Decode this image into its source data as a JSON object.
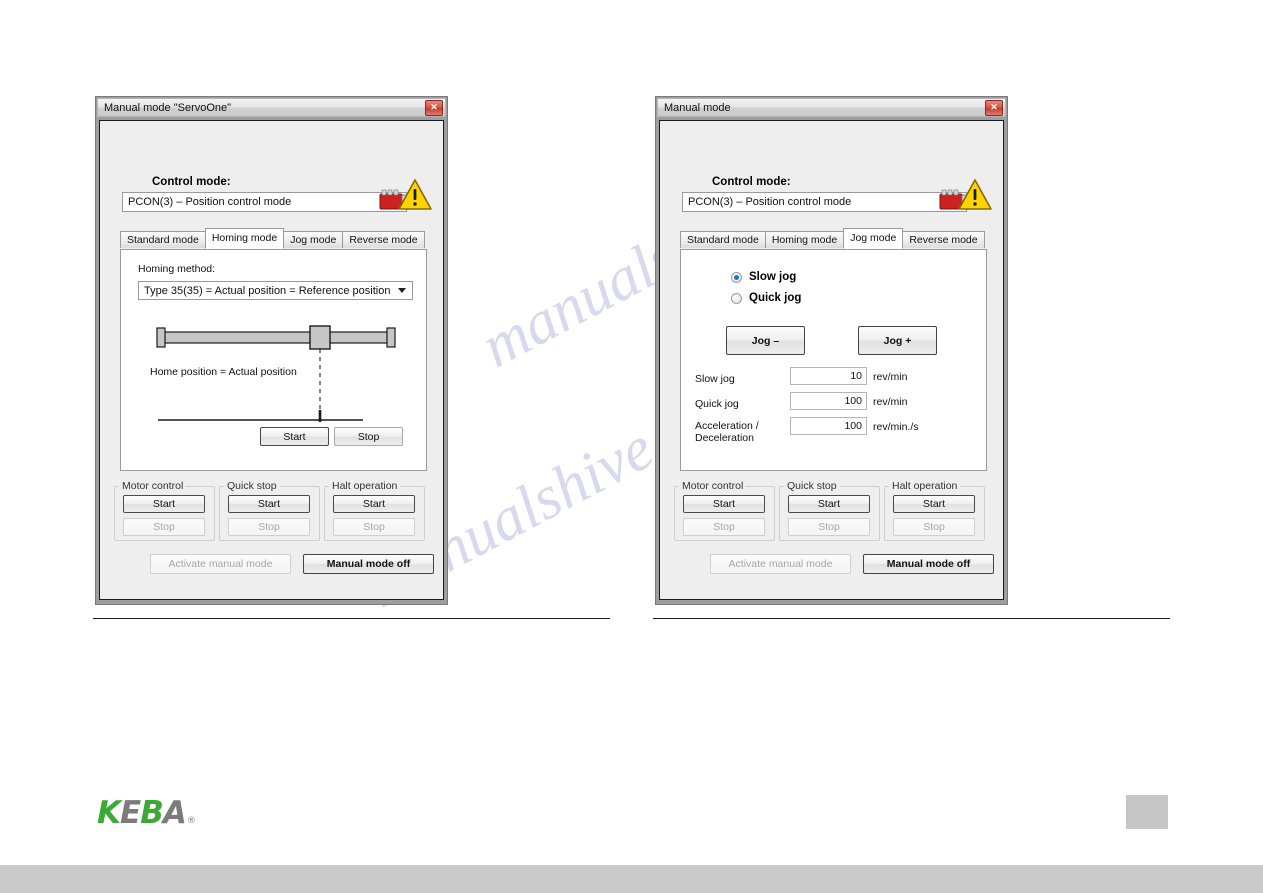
{
  "page": {
    "watermark_line1": "manualshive.com",
    "watermark_line2": "manualshive.com"
  },
  "brand": {
    "name_parts": [
      "K",
      "E",
      "B",
      "A"
    ],
    "trademark": "®",
    "green": "#3aa935",
    "gray": "#7b7b7b"
  },
  "common": {
    "control_mode_label": "Control mode:",
    "control_mode_value": "PCON(3) – Position control mode",
    "tabs": [
      {
        "label": "Standard mode"
      },
      {
        "label": "Homing mode"
      },
      {
        "label": "Jog mode"
      },
      {
        "label": "Reverse mode"
      }
    ],
    "groups": [
      {
        "title": "Motor control",
        "start": "Start",
        "stop": "Stop"
      },
      {
        "title": "Quick stop",
        "start": "Start",
        "stop": "Stop"
      },
      {
        "title": "Halt operation",
        "start": "Start",
        "stop": "Stop"
      }
    ],
    "activate_manual_mode": "Activate manual mode",
    "manual_mode_off": "Manual mode off",
    "close_glyph": "✕"
  },
  "window_left": {
    "title": "Manual mode \"ServoOne\"",
    "active_tab": "Homing mode",
    "homing": {
      "method_label": "Homing method:",
      "method_value": "Type 35(35) = Actual position = Reference position",
      "diagram_caption": "Home position = Actual position",
      "start_button": "Start",
      "stop_button": "Stop"
    }
  },
  "window_right": {
    "title": "Manual mode",
    "active_tab": "Jog mode",
    "jog": {
      "radio_slow": "Slow jog",
      "radio_quick": "Quick jog",
      "radio_selected": "Slow jog",
      "jog_minus": "Jog –",
      "jog_plus": "Jog +",
      "fields": [
        {
          "label": "Slow jog",
          "value": "10",
          "unit": "rev/min"
        },
        {
          "label": "Quick jog",
          "value": "100",
          "unit": "rev/min"
        },
        {
          "label": "Acceleration /",
          "label2": "Deceleration",
          "value": "100",
          "unit": "rev/min./s"
        }
      ]
    }
  }
}
